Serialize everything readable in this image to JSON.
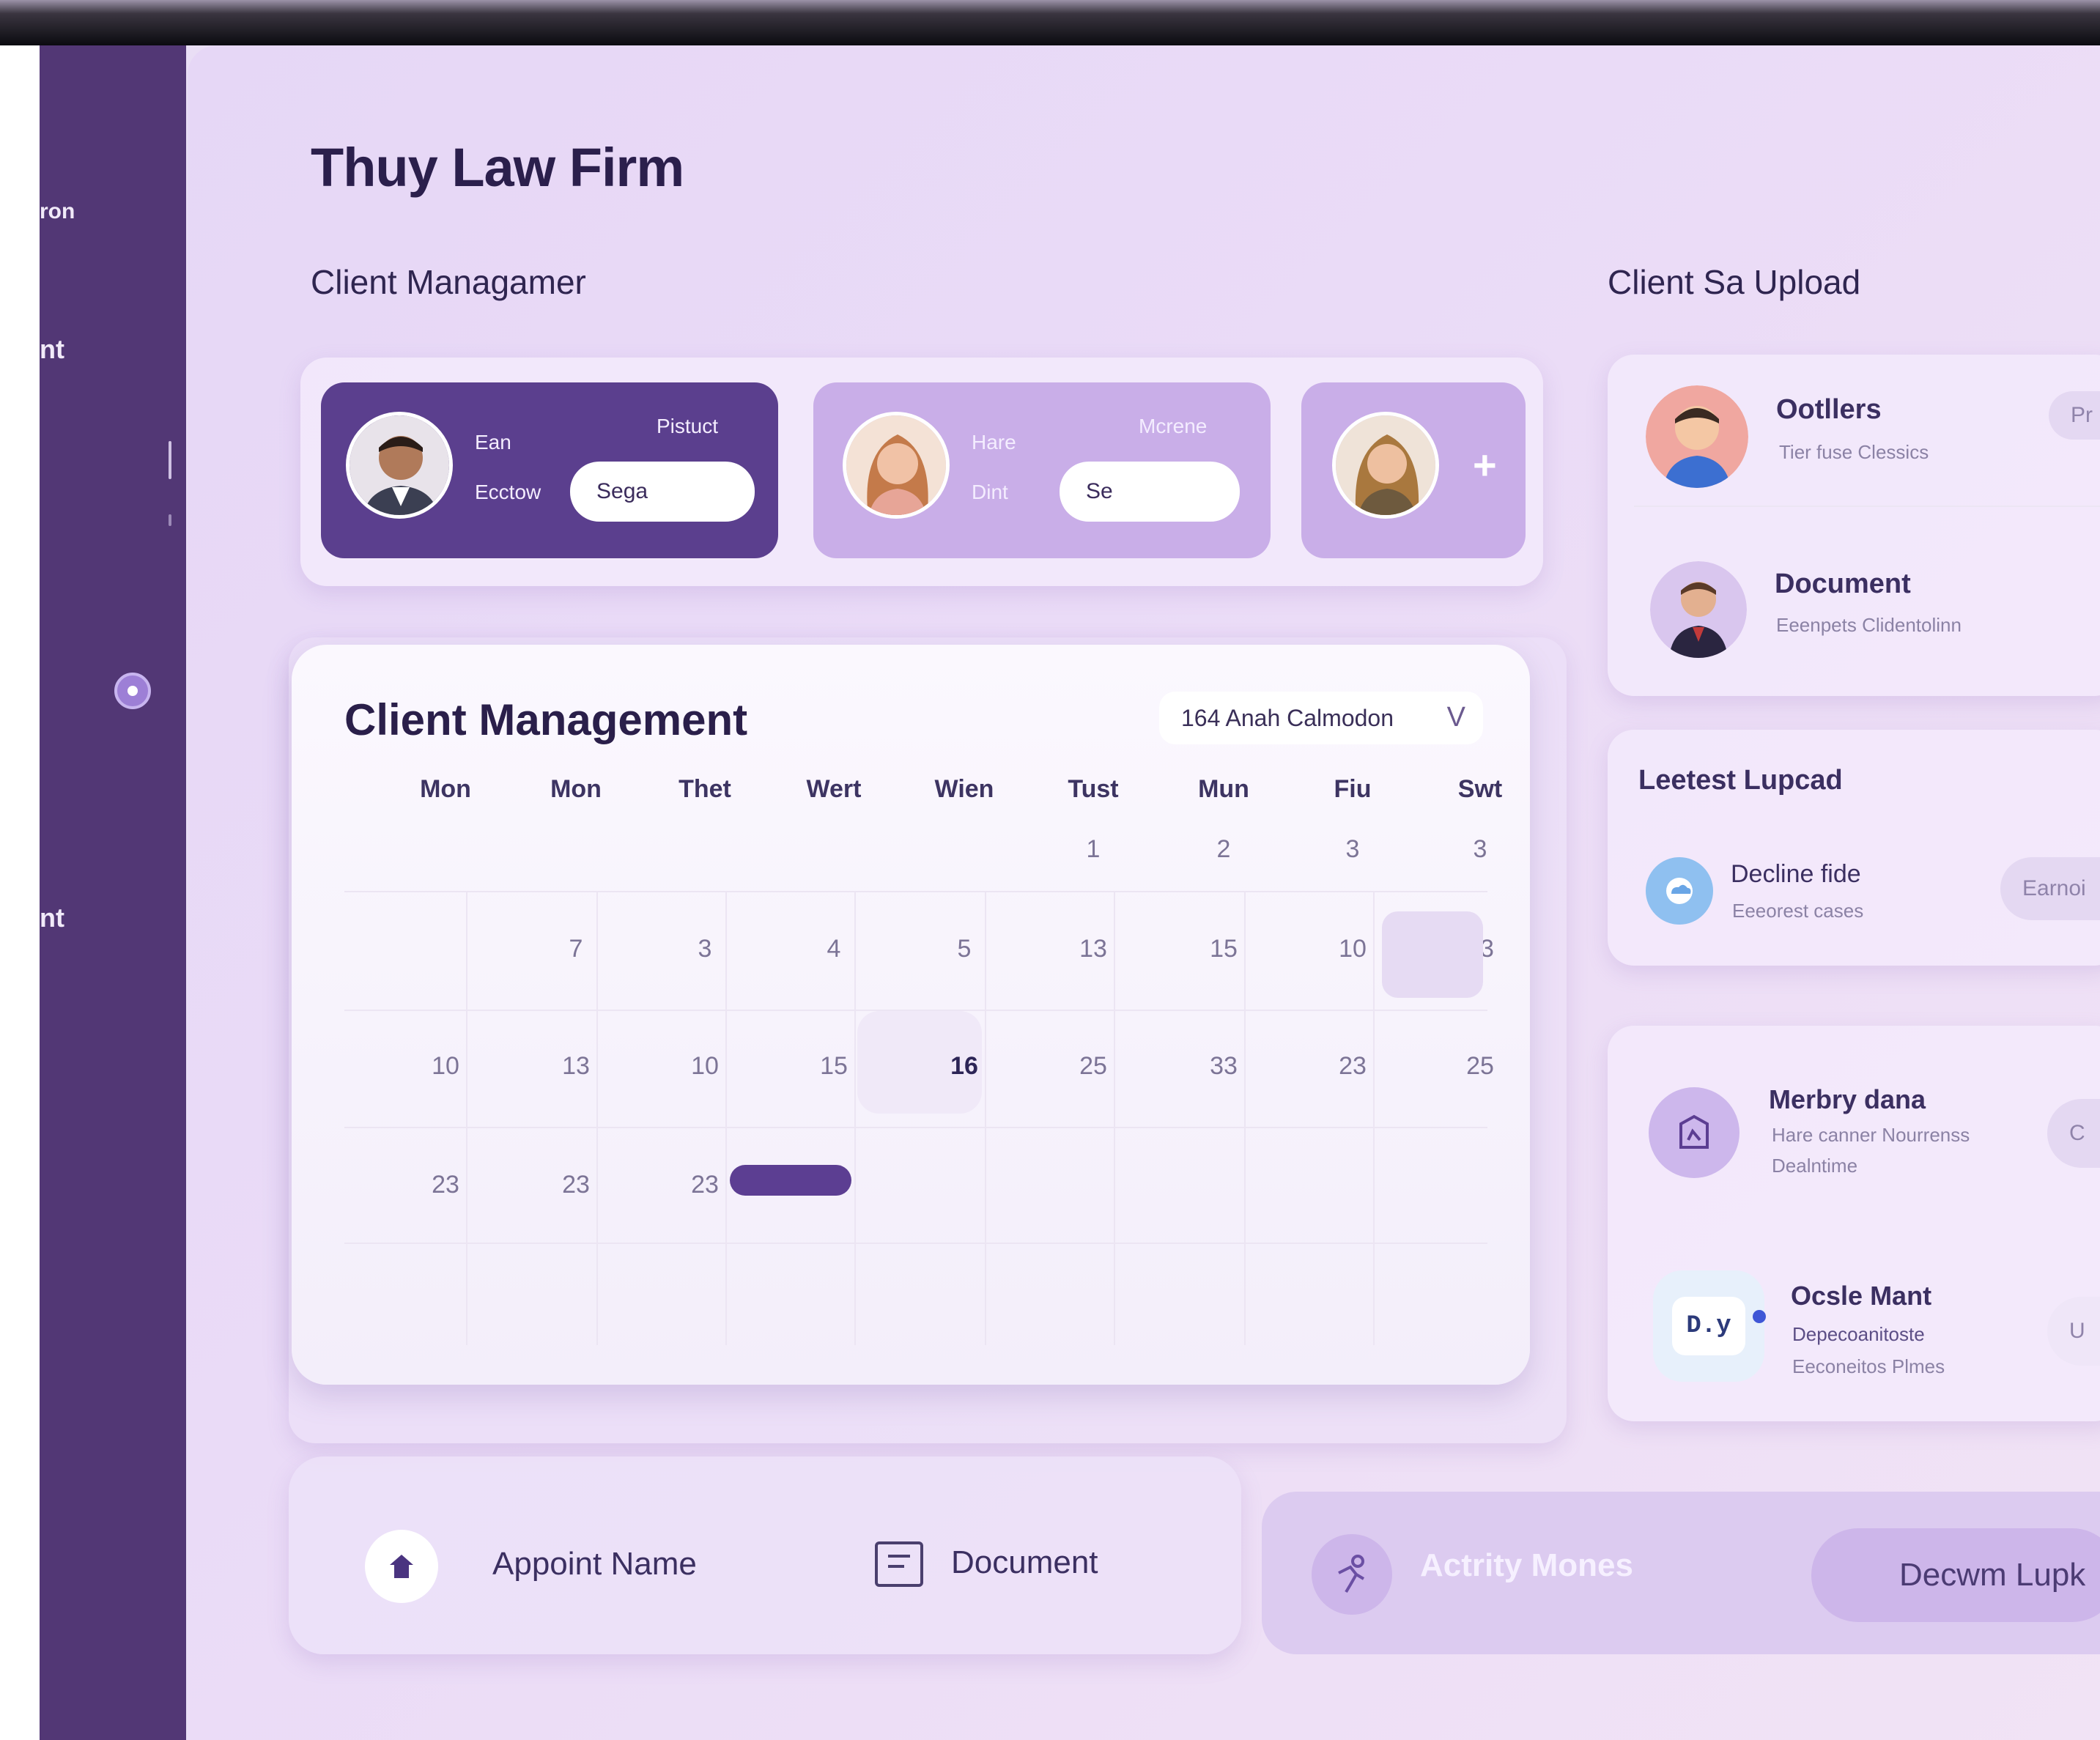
{
  "app": {
    "title": "Thuy Law Firm"
  },
  "sidebar": {
    "labels": [
      "ron",
      "nt",
      "nt"
    ]
  },
  "sections": {
    "client_manager": "Client Managamer",
    "client_upload": "Client Sa Upload"
  },
  "client_cards": [
    {
      "label_a": "Ean",
      "label_b": "Ecctow",
      "corner": "Pistuct",
      "input_value": "Sega"
    },
    {
      "label_a": "Hare",
      "label_b": "Dint",
      "corner": "Mcrene",
      "input_value": "Se"
    },
    {
      "plus": "+"
    }
  ],
  "calendar": {
    "title": "Client Management",
    "selector": "164 Anah Calmodon",
    "chevron": "V",
    "weekdays": [
      "Mon",
      "Mon",
      "Thet",
      "Wert",
      "Wien",
      "Tust",
      "Mun",
      "Fiu",
      "Swt"
    ],
    "rows": [
      [
        "",
        "",
        "",
        "",
        "",
        "1",
        "2",
        "3",
        "3"
      ],
      [
        "",
        "7",
        "3",
        "4",
        "5",
        "13",
        "15",
        "10",
        "13"
      ],
      [
        "10",
        "13",
        "10",
        "15",
        "16",
        "25",
        "33",
        "23",
        "25"
      ],
      [
        "23",
        "23",
        "23",
        "",
        "",
        "",
        "",
        "",
        ""
      ]
    ]
  },
  "right": {
    "top_items": [
      {
        "title": "Ootllers",
        "sub": "Tier fuse Clessics",
        "btn": "Pr"
      },
      {
        "title": "Document",
        "sub": "Eeenpets Clidentolinn"
      }
    ],
    "latest_title": "Leetest Lupcad",
    "latest_item": {
      "title": "Decline fide",
      "sub": "Eeeorest cases",
      "btn": "Earnoi"
    },
    "bottom_items": [
      {
        "title": "Merbry dana",
        "sub1": "Hare canner Nourrenss",
        "sub2": "Dealntime",
        "btn": "C"
      },
      {
        "title": "Ocsle Mant",
        "sub1": "Depecoanitoste",
        "sub2": "Eeconeitos Plmes",
        "btn": "U",
        "glyph": "D.y"
      }
    ]
  },
  "bottom": {
    "appoint": "Appoint Name",
    "document": "Document",
    "activity": "Actrity Mones",
    "upload_pill": "Decwm Lupk"
  },
  "colors": {
    "sidebar": "#523775",
    "accent": "#5b3f8e",
    "accent_light": "#c9aee8"
  }
}
